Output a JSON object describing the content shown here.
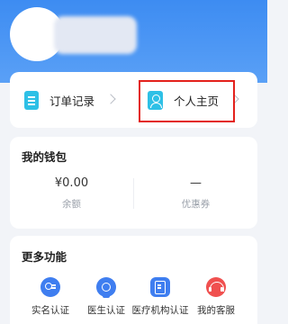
{
  "nav": {
    "orders_label": "订单记录",
    "profile_label": "个人主页"
  },
  "wallet": {
    "title": "我的钱包",
    "balance_value": "¥0.00",
    "balance_label": "余额",
    "coupon_value": "—",
    "coupon_label": "优惠券"
  },
  "more": {
    "title": "更多功能",
    "items": [
      {
        "label": "实名认证",
        "icon": "id-verify-icon"
      },
      {
        "label": "医生认证",
        "icon": "doctor-verify-icon"
      },
      {
        "label": "医疗机构认证",
        "icon": "institution-verify-icon"
      },
      {
        "label": "我的客服",
        "icon": "customer-service-icon"
      }
    ]
  },
  "colors": {
    "header_blue": "#3d8cf2",
    "accent_blue": "#3f7ef0",
    "icon_cyan": "#2ec0e6",
    "highlight_red": "#e3211c",
    "service_red": "#f0504f"
  }
}
